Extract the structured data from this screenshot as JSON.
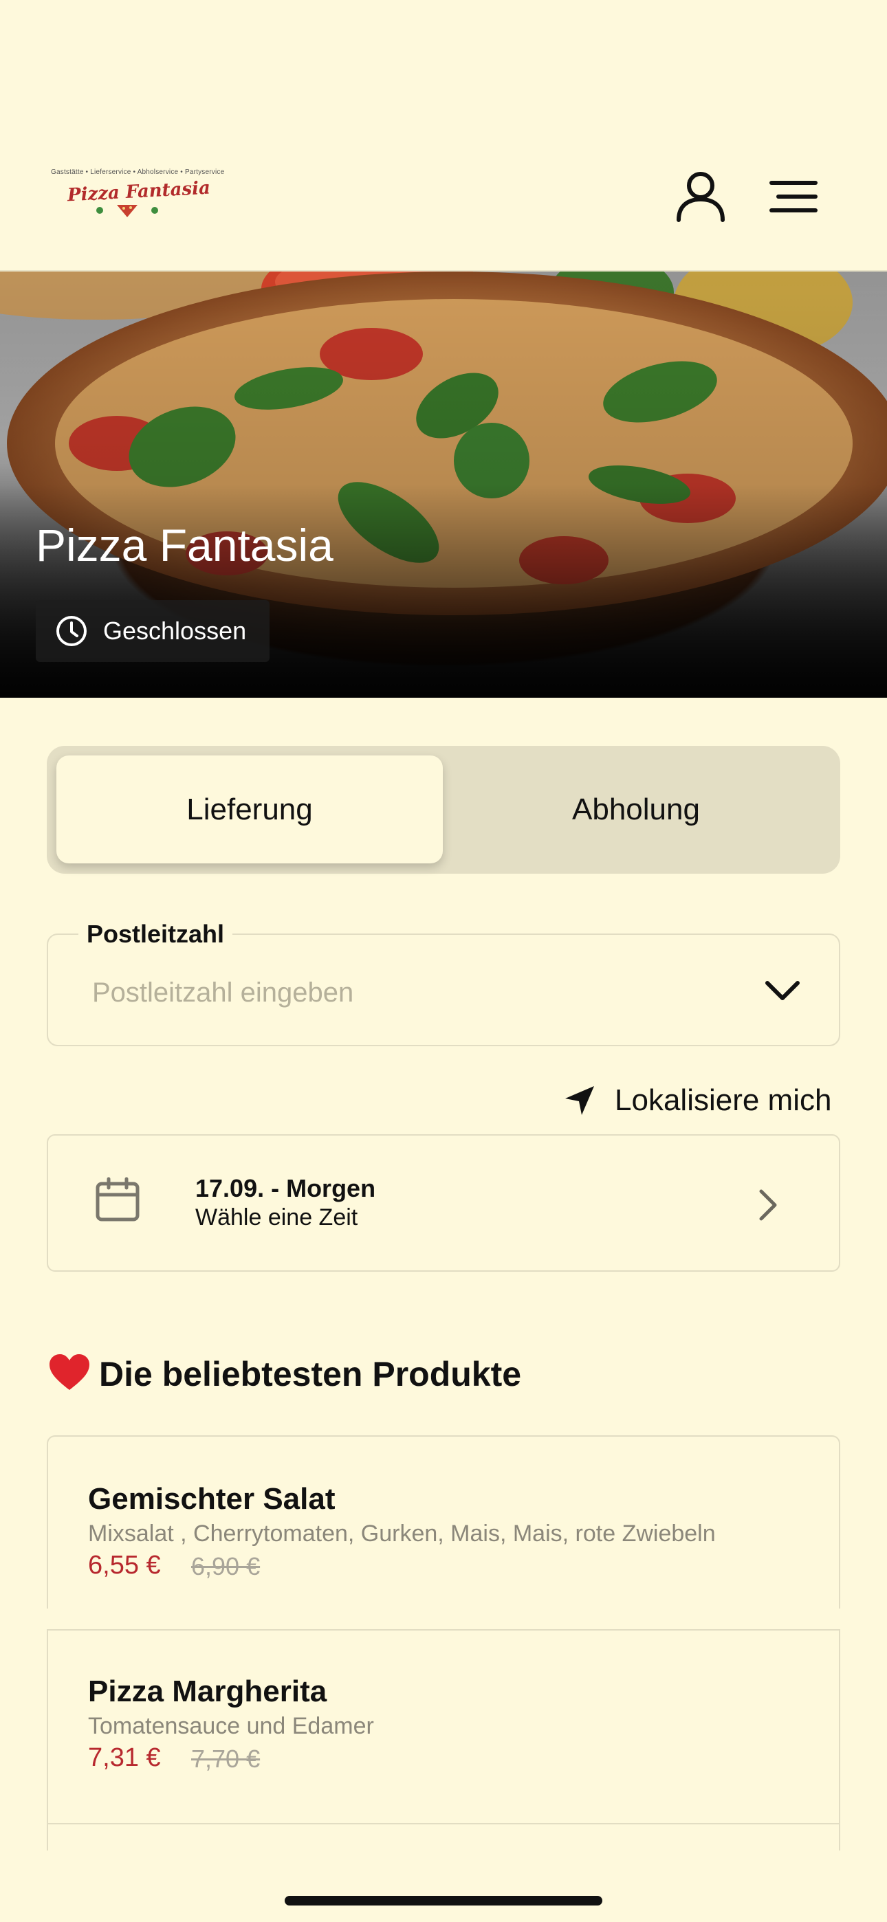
{
  "header": {
    "logo": {
      "tagline": "Gaststätte • Lieferservice • Abholservice • Partyservice",
      "name": "Pizza Fantasia"
    },
    "icons": [
      "user-icon",
      "menu-icon"
    ]
  },
  "hero": {
    "title": "Pizza Fantasia",
    "status": "Geschlossen"
  },
  "order_mode": {
    "options": [
      "Lieferung",
      "Abholung"
    ],
    "selected": "Lieferung"
  },
  "zip": {
    "label": "Postleitzahl",
    "placeholder": "Postleitzahl eingeben"
  },
  "locate": {
    "label": "Lokalisiere mich"
  },
  "date": {
    "main": "17.09. - Morgen",
    "sub": "Wähle eine Zeit"
  },
  "popular": {
    "title": "Die beliebtesten Produkte",
    "products": [
      {
        "name": "Gemischter Salat",
        "description": "Mixsalat , Cherrytomaten, Gurken, Mais, Mais, rote Zwiebeln",
        "price": "6,55 €",
        "old_price": "6,90 €"
      },
      {
        "name": "Pizza Margherita",
        "description": "Tomatensauce und Edamer",
        "price": "7,31 €",
        "old_price": "7,70 €"
      }
    ]
  },
  "colors": {
    "background": "#FEF9DC",
    "segment_bg": "#E3DEC4",
    "price_red": "#B7282E",
    "muted_text": "#8B877A"
  }
}
